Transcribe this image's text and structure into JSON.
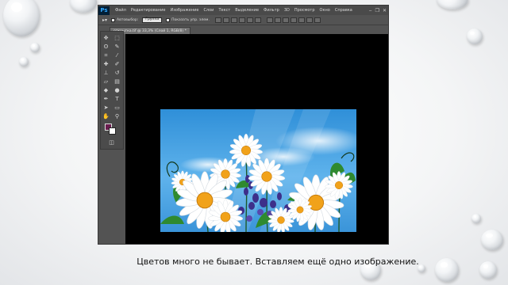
{
  "app": {
    "logo_text": "Ps",
    "menu": [
      "Файл",
      "Редактирование",
      "Изображение",
      "Слои",
      "Текст",
      "Выделение",
      "Фильтр",
      "3D",
      "Просмотр",
      "Окно",
      "Справка"
    ],
    "window_controls": [
      "‒",
      "❐",
      "✕"
    ]
  },
  "options_bar": {
    "autoselect_label": "Автовыбор:",
    "autoselect_value": "Группа",
    "transform_controls_label": "Показать упр. элем."
  },
  "document": {
    "tab_title": "открытка.tif @ 33,3% (Слой 1, RGB/8) *"
  },
  "colors": {
    "foreground": "#6a1d4f",
    "background": "#ffffff",
    "accent": "#31a8ff"
  },
  "caption": {
    "text": "Цветов много не бывает. Вставляем ещё одно изображение."
  }
}
